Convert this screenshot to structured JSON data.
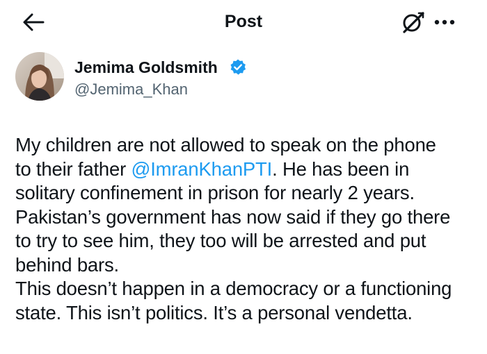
{
  "header": {
    "title": "Post",
    "back_icon": "arrow-left-icon",
    "grok_icon": "grok-icon",
    "more_icon": "more-horizontal-icon"
  },
  "author": {
    "display_name": "Jemima Goldsmith",
    "handle": "@Jemima_Khan",
    "verified_icon": "verified-badge-icon",
    "verified_color": "#1d9bf0"
  },
  "post": {
    "line1": "My children are not allowed to speak on the phone",
    "line2_before": "to their father ",
    "mention": "@ImranKhanPTI",
    "line2_after": ". He has been in",
    "line3": "solitary confinement in prison for nearly 2 years.",
    "line4": "Pakistan’s government has now said if they go there",
    "line5": "to try to see him, they too will be arrested and put",
    "line6": "behind bars.",
    "line7": "This doesn’t happen in a democracy or a functioning",
    "line8": "state. This isn’t politics. It’s a personal vendetta.",
    "mention_color": "#1d9bf0"
  }
}
